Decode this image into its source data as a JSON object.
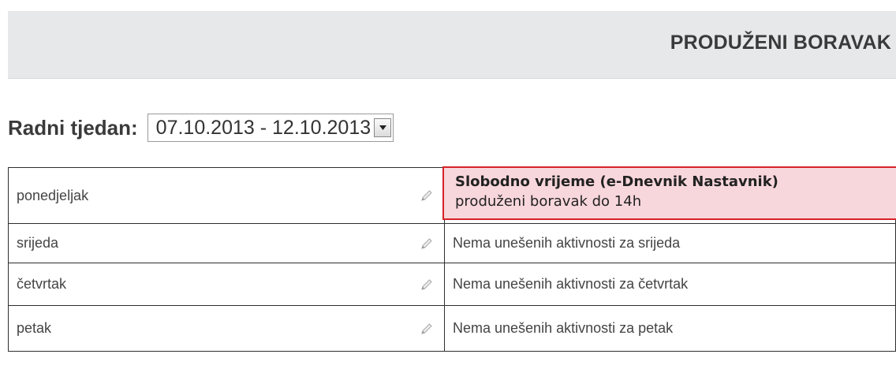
{
  "header": {
    "title": "PRODUŽENI BORAVAK"
  },
  "week_selector": {
    "label": "Radni tjedan:",
    "selected": "07.10.2013 - 12.10.2013"
  },
  "schedule": [
    {
      "day": "ponedjeljak",
      "activity_title": "Slobodno vrijeme (e-Dnevnik Nastavnik)",
      "activity_desc": "produženi boravak do 14h"
    },
    {
      "day": "srijeda",
      "activity_text": "Nema unešenih aktivnosti za srijeda"
    },
    {
      "day": "četvrtak",
      "activity_text": "Nema unešenih aktivnosti za četvrtak"
    },
    {
      "day": "petak",
      "activity_text": "Nema unešenih aktivnosti za petak"
    }
  ],
  "colors": {
    "header_bg": "#e6e8ea",
    "highlight_bg": "#f8d7dc",
    "highlight_border": "#d6232a"
  },
  "icons": {
    "edit": "pencil-icon",
    "dropdown": "chevron-down-icon"
  }
}
